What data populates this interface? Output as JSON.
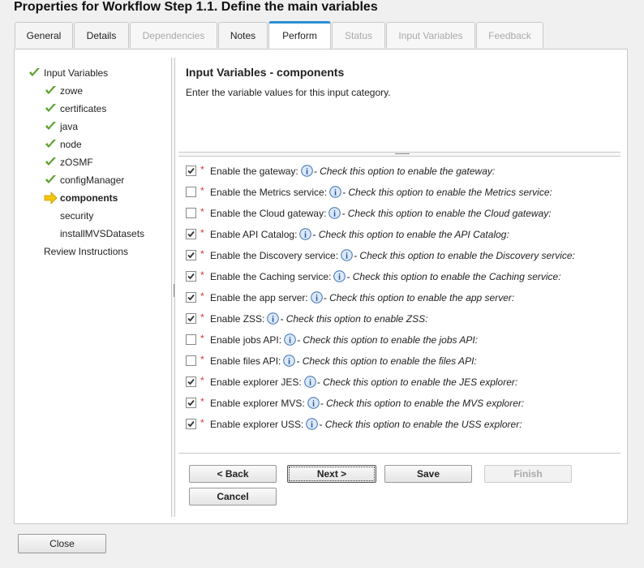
{
  "dialog": {
    "title": "Properties for Workflow Step 1.1. Define the main variables"
  },
  "tabs": [
    {
      "label": "General",
      "state": "normal"
    },
    {
      "label": "Details",
      "state": "normal"
    },
    {
      "label": "Dependencies",
      "state": "disabled"
    },
    {
      "label": "Notes",
      "state": "normal"
    },
    {
      "label": "Perform",
      "state": "active"
    },
    {
      "label": "Status",
      "state": "disabled"
    },
    {
      "label": "Input Variables",
      "state": "disabled"
    },
    {
      "label": "Feedback",
      "state": "disabled"
    }
  ],
  "nav": {
    "items": [
      {
        "label": "Input Variables",
        "status": "complete"
      },
      {
        "label": "zowe",
        "status": "complete"
      },
      {
        "label": "certificates",
        "status": "complete"
      },
      {
        "label": "java",
        "status": "complete"
      },
      {
        "label": "node",
        "status": "complete"
      },
      {
        "label": "zOSMF",
        "status": "complete"
      },
      {
        "label": "configManager",
        "status": "complete"
      },
      {
        "label": "components",
        "status": "current"
      },
      {
        "label": "security",
        "status": "pending"
      },
      {
        "label": "installMVSDatasets",
        "status": "pending"
      },
      {
        "label": "Review Instructions",
        "status": "pending"
      }
    ]
  },
  "content": {
    "title": "Input Variables - components",
    "description": "Enter the variable values for this input category."
  },
  "variables": [
    {
      "label": "Enable the gateway:",
      "desc": "- Check this option to enable the gateway:",
      "checked": true
    },
    {
      "label": "Enable the Metrics service:",
      "desc": "- Check this option to enable the Metrics service:",
      "checked": false
    },
    {
      "label": "Enable the Cloud gateway:",
      "desc": "- Check this option to enable the Cloud gateway:",
      "checked": false
    },
    {
      "label": "Enable API Catalog:",
      "desc": "- Check this option to enable the API Catalog:",
      "checked": true
    },
    {
      "label": "Enable the Discovery service:",
      "desc": "- Check this option to enable the Discovery service:",
      "checked": true
    },
    {
      "label": "Enable the Caching service:",
      "desc": "- Check this option to enable the Caching service:",
      "checked": true
    },
    {
      "label": "Enable the app server:",
      "desc": "- Check this option to enable the app server:",
      "checked": true
    },
    {
      "label": "Enable ZSS:",
      "desc": "- Check this option to enable ZSS:",
      "checked": true
    },
    {
      "label": "Enable jobs API:",
      "desc": "- Check this option to enable the jobs API:",
      "checked": false
    },
    {
      "label": "Enable files API:",
      "desc": "- Check this option to enable the files API:",
      "checked": false
    },
    {
      "label": "Enable explorer JES:",
      "desc": "- Check this option to enable the JES explorer:",
      "checked": true
    },
    {
      "label": "Enable explorer MVS:",
      "desc": "- Check this option to enable the MVS explorer:",
      "checked": true
    },
    {
      "label": "Enable explorer USS:",
      "desc": "- Check this option to enable the USS explorer:",
      "checked": true
    }
  ],
  "required_marker": "*",
  "buttons": {
    "back": "< Back",
    "next": "Next >",
    "save": "Save",
    "finish": "Finish",
    "cancel": "Cancel",
    "close": "Close"
  },
  "colors": {
    "accent": "#2a8fd3",
    "check": "#5aa02c",
    "current_arrow": "#f2c40c",
    "required": "#d33333"
  },
  "icons": {
    "complete": "green-check-icon",
    "current": "yellow-arrow-icon",
    "info": "info-icon"
  }
}
